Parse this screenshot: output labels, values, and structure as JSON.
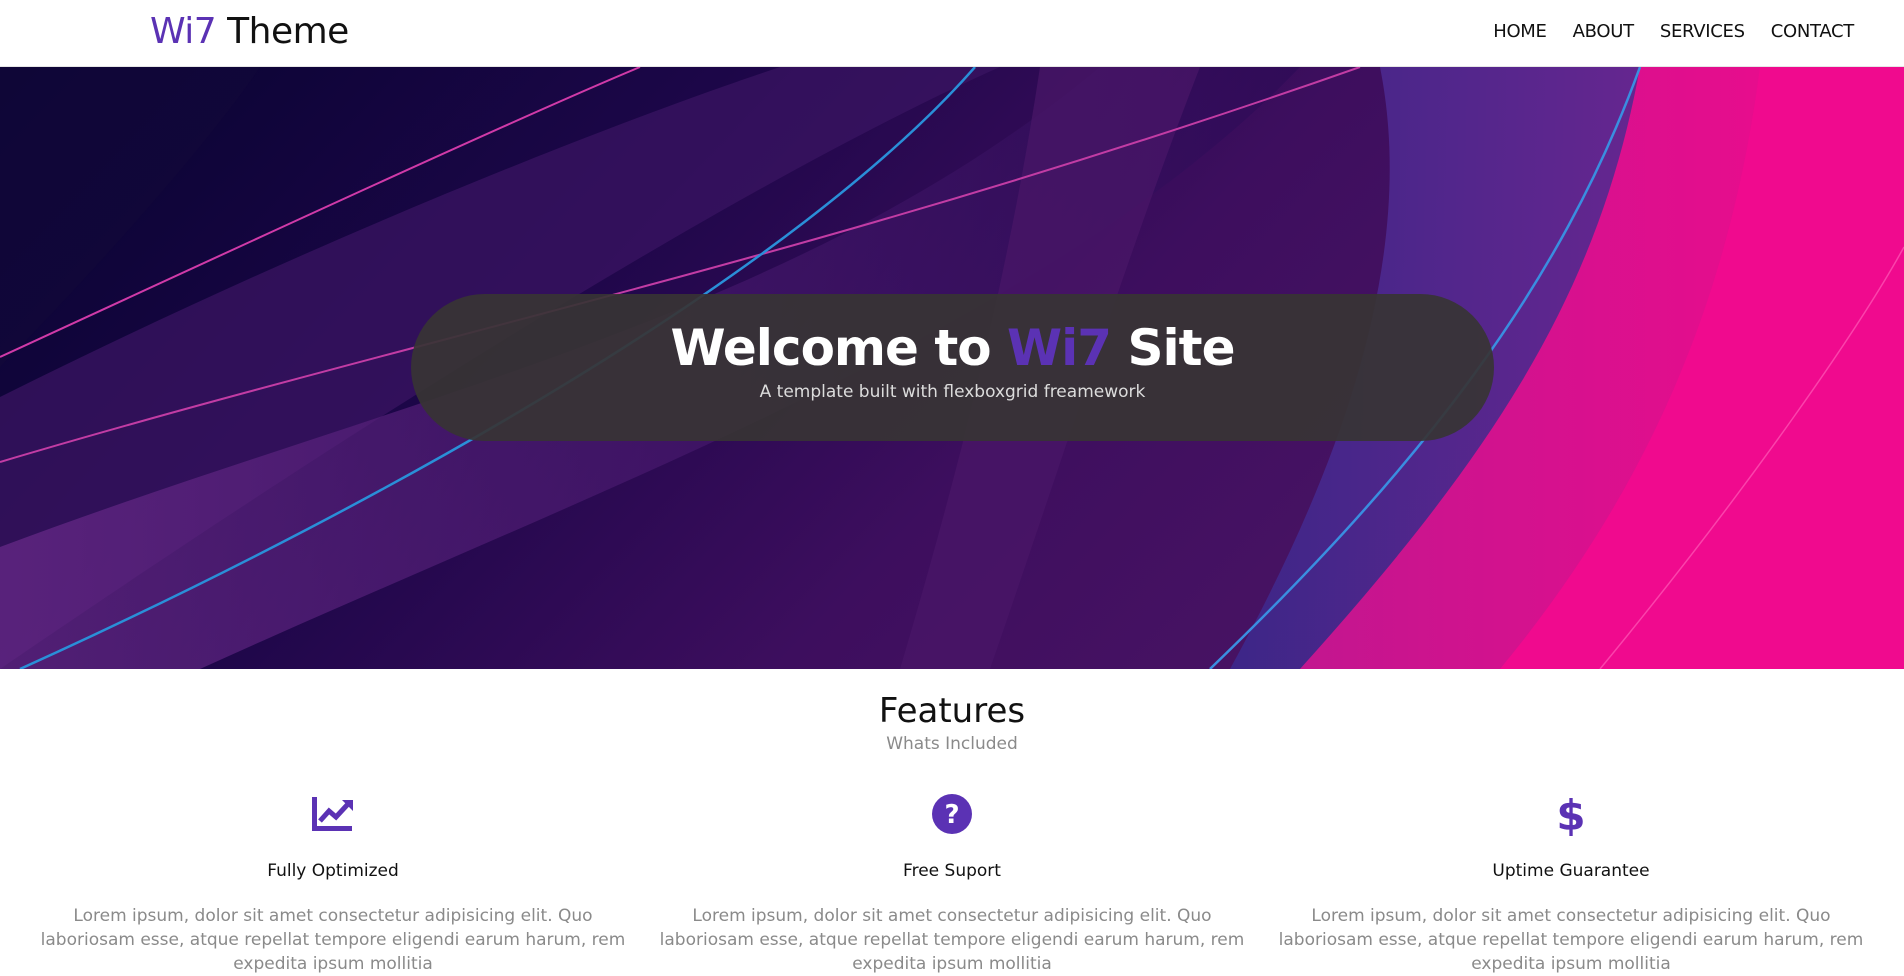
{
  "nav": {
    "logo_accent": "Wi7",
    "logo_rest": " Theme",
    "links": [
      "HOME",
      "ABOUT",
      "SERVICES",
      "CONTACT"
    ]
  },
  "hero": {
    "title_prefix": "Welcome to ",
    "title_accent": "Wi7",
    "title_suffix": " Site",
    "subtitle": "A template built with flexboxgrid freamework"
  },
  "features": {
    "title": "Features",
    "subtitle": "Whats Included",
    "items": [
      {
        "icon": "chart-line-icon",
        "title": "Fully Optimized",
        "text": "Lorem ipsum, dolor sit amet consectetur adipisicing elit. Quo laboriosam esse, atque repellat tempore eligendi earum harum, rem expedita ipsum mollitia"
      },
      {
        "icon": "question-circle-icon",
        "title": "Free Suport",
        "text": "Lorem ipsum, dolor sit amet consectetur adipisicing elit. Quo laboriosam esse, atque repellat tempore eligendi earum harum, rem expedita ipsum mollitia"
      },
      {
        "icon": "dollar-sign-icon",
        "title": "Uptime Guarantee",
        "text": "Lorem ipsum, dolor sit amet consectetur adipisicing elit. Quo laboriosam esse, atque repellat tempore eligendi earum harum, rem expedita ipsum mollitia"
      }
    ]
  },
  "colors": {
    "accent": "#5b32b4",
    "hero_box": "#373434",
    "muted_text": "#8a8a8a"
  }
}
